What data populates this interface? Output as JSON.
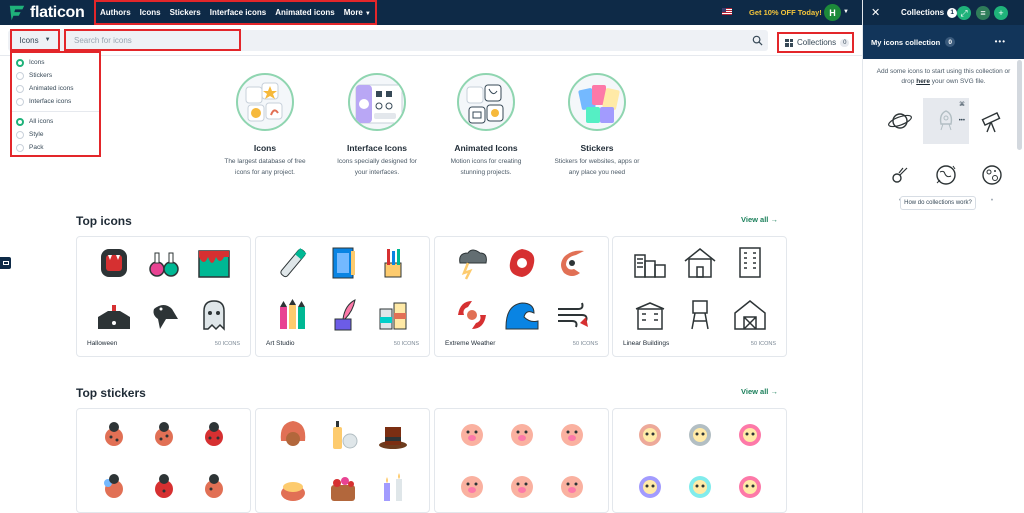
{
  "brand": {
    "name": "flaticon",
    "accent": "#1fb27a",
    "navy": "#0e2a47"
  },
  "nav": {
    "items": [
      "Authors",
      "Icons",
      "Stickers",
      "Interface icons",
      "Animated icons",
      "More"
    ],
    "offer": "Get 10% OFF Today!",
    "avatar_initial": "H"
  },
  "search": {
    "type_label": "Icons",
    "placeholder": "Search for icons",
    "collections_label": "Collections",
    "collections_count": "0"
  },
  "dropdown": {
    "types": [
      {
        "label": "Icons",
        "selected": true
      },
      {
        "label": "Stickers",
        "selected": false
      },
      {
        "label": "Animated icons",
        "selected": false
      },
      {
        "label": "Interface icons",
        "selected": false
      }
    ],
    "scopes": [
      {
        "label": "All icons",
        "selected": true
      },
      {
        "label": "Style",
        "selected": false
      },
      {
        "label": "Pack",
        "selected": false
      }
    ]
  },
  "categories": [
    {
      "title": "Icons",
      "desc1": "The largest database of free",
      "desc2": "icons for any project."
    },
    {
      "title": "Interface Icons",
      "desc1": "Icons specially designed for",
      "desc2": "your interfaces."
    },
    {
      "title": "Animated Icons",
      "desc1": "Motion icons for creating",
      "desc2": "stunning projects."
    },
    {
      "title": "Stickers",
      "desc1": "Stickers for websites, apps or",
      "desc2": "any place you need"
    }
  ],
  "top_icons": {
    "title": "Top icons",
    "view_all": "View all",
    "cards": [
      {
        "name": "Halloween",
        "count": "50 ICONS",
        "icons": [
          "vampire-mouth-icon",
          "potion-bottles-icon",
          "slime-icon",
          "haunted-house-icon",
          "crow-icon",
          "ghost-icon"
        ]
      },
      {
        "name": "Art Studio",
        "count": "50 ICONS",
        "icons": [
          "paint-tube-icon",
          "sketchbook-icon",
          "brush-jar-icon",
          "crayons-icon",
          "quill-ink-icon",
          "paint-bottles-icon"
        ]
      },
      {
        "name": "Extreme Weather",
        "count": "50 ICONS",
        "icons": [
          "thunderstorm-icon",
          "hurricane-icon",
          "typhoon-icon",
          "cyclone-icon",
          "tsunami-icon",
          "strong-wind-icon"
        ]
      },
      {
        "name": "Linear Buildings",
        "count": "50 ICONS",
        "icons": [
          "factory-icon",
          "house-icon",
          "office-tower-icon",
          "apartment-icon",
          "water-tower-icon",
          "barn-icon"
        ]
      }
    ]
  },
  "top_stickers": {
    "title": "Top stickers",
    "view_all": "View all"
  },
  "panel": {
    "title": "Collections",
    "title_count": "1",
    "collection_name": "My icons collection",
    "collection_count": "0",
    "hint_before": "Add some icons to start using this collection or drop",
    "hint_link": "here",
    "hint_after": "your own SVG file.",
    "how_label": "How do collections work?",
    "slots": [
      "planet-icon",
      "rocket-icon",
      "telescope-icon",
      "comet-icon",
      "earth-icon",
      "moon-icon"
    ]
  }
}
